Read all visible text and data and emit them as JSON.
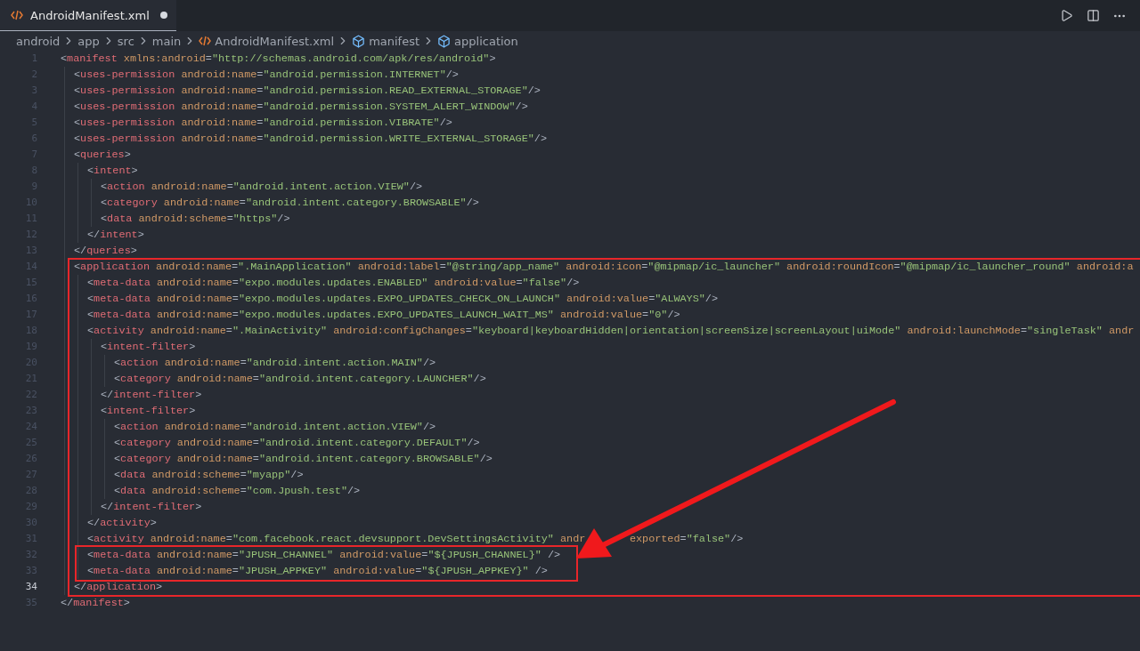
{
  "tab": {
    "title": "AndroidManifest.xml",
    "modified": true
  },
  "breadcrumbs": [
    {
      "text": "android",
      "kind": "folder"
    },
    {
      "text": "app",
      "kind": "folder"
    },
    {
      "text": "src",
      "kind": "folder"
    },
    {
      "text": "main",
      "kind": "folder"
    },
    {
      "text": "AndroidManifest.xml",
      "kind": "file"
    },
    {
      "text": "manifest",
      "kind": "symbol"
    },
    {
      "text": "application",
      "kind": "symbol"
    }
  ],
  "lines": [
    {
      "number": "1",
      "current": false,
      "text": "<manifest xmlns:android=\"http://schemas.android.com/apk/res/android\">",
      "children": [
        {
          "number": "2",
          "current": false,
          "text": "<uses-permission android:name=\"android.permission.INTERNET\"/>"
        },
        {
          "number": "3",
          "current": false,
          "text": "<uses-permission android:name=\"android.permission.READ_EXTERNAL_STORAGE\"/>"
        },
        {
          "number": "4",
          "current": false,
          "text": "<uses-permission android:name=\"android.permission.SYSTEM_ALERT_WINDOW\"/>"
        },
        {
          "number": "5",
          "current": false,
          "text": "<uses-permission android:name=\"android.permission.VIBRATE\"/>"
        },
        {
          "number": "6",
          "current": false,
          "text": "<uses-permission android:name=\"android.permission.WRITE_EXTERNAL_STORAGE\"/>"
        },
        {
          "number": "7",
          "current": false,
          "text": "<queries>",
          "children": [
            {
              "number": "8",
              "current": false,
              "text": "<intent>",
              "children": [
                {
                  "number": "9",
                  "current": false,
                  "text": "<action android:name=\"android.intent.action.VIEW\"/>"
                },
                {
                  "number": "10",
                  "current": false,
                  "text": "<category android:name=\"android.intent.category.BROWSABLE\"/>"
                },
                {
                  "number": "11",
                  "current": false,
                  "text": "<data android:scheme=\"https\"/>"
                }
              ]
            },
            {
              "number": "12",
              "current": false,
              "text": "</intent>"
            }
          ]
        },
        {
          "number": "13",
          "current": false,
          "text": "</queries>"
        },
        {
          "number": "14",
          "current": false,
          "text": "<application android:name=\".MainApplication\" android:label=\"@string/app_name\" android:icon=\"@mipmap/ic_launcher\" android:roundIcon=\"@mipmap/ic_launcher_round\" android:a",
          "children": [
            {
              "number": "15",
              "current": false,
              "text": "<meta-data android:name=\"expo.modules.updates.ENABLED\" android:value=\"false\"/>"
            },
            {
              "number": "16",
              "current": false,
              "text": "<meta-data android:name=\"expo.modules.updates.EXPO_UPDATES_CHECK_ON_LAUNCH\" android:value=\"ALWAYS\"/>"
            },
            {
              "number": "17",
              "current": false,
              "text": "<meta-data android:name=\"expo.modules.updates.EXPO_UPDATES_LAUNCH_WAIT_MS\" android:value=\"0\"/>"
            },
            {
              "number": "18",
              "current": false,
              "text": "<activity android:name=\".MainActivity\" android:configChanges=\"keyboard|keyboardHidden|orientation|screenSize|screenLayout|uiMode\" android:launchMode=\"singleTask\" andr",
              "children": [
                {
                  "number": "19",
                  "current": false,
                  "text": "<intent-filter>",
                  "children": [
                    {
                      "number": "20",
                      "current": false,
                      "text": "<action android:name=\"android.intent.action.MAIN\"/>"
                    },
                    {
                      "number": "21",
                      "current": false,
                      "text": "<category android:name=\"android.intent.category.LAUNCHER\"/>"
                    }
                  ]
                },
                {
                  "number": "22",
                  "current": false,
                  "text": "</intent-filter>"
                },
                {
                  "number": "23",
                  "current": false,
                  "text": "<intent-filter>",
                  "children": [
                    {
                      "number": "24",
                      "current": false,
                      "text": "<action android:name=\"android.intent.action.VIEW\"/>"
                    },
                    {
                      "number": "25",
                      "current": false,
                      "text": "<category android:name=\"android.intent.category.DEFAULT\"/>"
                    },
                    {
                      "number": "26",
                      "current": false,
                      "text": "<category android:name=\"android.intent.category.BROWSABLE\"/>"
                    },
                    {
                      "number": "27",
                      "current": false,
                      "text": "<data android:scheme=\"myapp\"/>"
                    },
                    {
                      "number": "28",
                      "current": false,
                      "text": "<data android:scheme=\"com.Jpush.test\"/>"
                    }
                  ]
                },
                {
                  "number": "29",
                  "current": false,
                  "text": "</intent-filter>"
                }
              ]
            },
            {
              "number": "30",
              "current": false,
              "text": "</activity>"
            },
            {
              "number": "31",
              "current": false,
              "text": "<activity android:name=\"com.facebook.react.devsupport.DevSettingsActivity\" andr",
              "after": "exported=\"false\"/>"
            },
            {
              "number": "32",
              "current": false,
              "text": "<meta-data android:name=\"JPUSH_CHANNEL\" android:value=\"${JPUSH_CHANNEL}\" />"
            },
            {
              "number": "33",
              "current": false,
              "text": "<meta-data android:name=\"JPUSH_APPKEY\" android:value=\"${JPUSH_APPKEY}\" />"
            }
          ]
        },
        {
          "number": "34",
          "current": true,
          "text": "</application>"
        }
      ]
    },
    {
      "number": "35",
      "current": false,
      "text": "</manifest>"
    }
  ],
  "annotations": [
    {
      "kind": "wide-box"
    },
    {
      "kind": "box"
    },
    {
      "kind": "arrow"
    }
  ]
}
